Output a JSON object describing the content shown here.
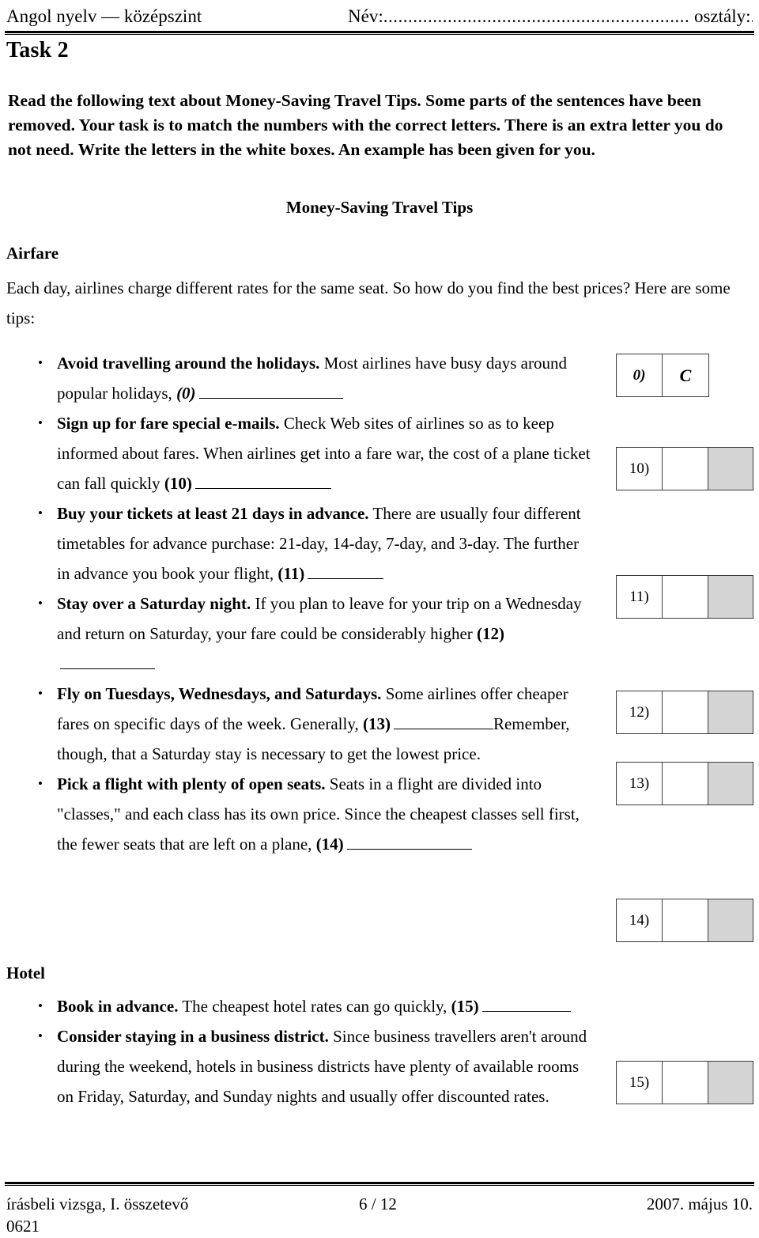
{
  "header": {
    "subject": "Angol nyelv — középszint",
    "name_label": "Név:",
    "name_dots": "..............................................................",
    "class_label": "osztály:......"
  },
  "task": {
    "title": "Task 2",
    "instructions": "Read the following text about Money-Saving Travel Tips. Some parts of the sentences have been removed. Your task is to match the numbers with the correct letters. There is an extra letter you do not need.  Write the letters in the white boxes. An example has been given for you."
  },
  "document": {
    "title": "Money-Saving Travel Tips",
    "sections": [
      {
        "heading": "Airfare",
        "intro": "Each day, airlines charge different rates for the same seat. So how do you find the best prices? Here are some tips:",
        "bullets": [
          {
            "lead": "Avoid travelling around the holidays.",
            "body_before": " Most airlines have busy days around popular holidays,",
            "number": "(0)",
            "body_after": ""
          },
          {
            "lead": "Sign up for fare special e-mails.",
            "body_before": " Check Web sites of airlines so as to keep informed about fares. When airlines get into a fare war, the cost of a plane ticket can fall quickly",
            "number": "(10)",
            "body_after": ""
          },
          {
            "lead": "Buy your tickets at least 21 days in advance.",
            "body_before": " There are usually four different timetables for advance purchase: 21-day, 14-day, 7-day, and 3-day. The further in advance you book your flight,",
            "number": "(11)",
            "body_after": ""
          },
          {
            "lead": "Stay over a Saturday night.",
            "body_before": " If you plan to leave for your trip on a Wednesday and return on Saturday, your fare could be considerably higher",
            "number": "(12)",
            "body_after": ""
          },
          {
            "lead": "Fly on Tuesdays, Wednesdays, and Saturdays.",
            "body_before": " Some airlines offer cheaper fares on specific days of the week. Generally,",
            "number": "(13)",
            "body_after": "Remember, though, that a Saturday stay is necessary to get the lowest price."
          },
          {
            "lead": "Pick a flight with plenty of open seats.",
            "body_before": " Seats in a flight are divided into \"classes,\" and each class has its own price. Since the cheapest classes sell first, the fewer seats that are left on a plane,",
            "number": "(14)",
            "body_after": ""
          }
        ]
      },
      {
        "heading": "Hotel",
        "bullets": [
          {
            "lead": "Book in advance.",
            "body_before": "  The cheapest hotel rates can go quickly,",
            "number": "(15)",
            "body_after": ""
          },
          {
            "lead": "Consider staying in a business district.",
            "body_before": " Since business travellers aren't around during the weekend, hotels in business districts have plenty of available rooms on Friday, Saturday, and Sunday nights and usually offer discounted rates.",
            "number": "",
            "body_after": ""
          }
        ]
      }
    ]
  },
  "answer_boxes": [
    {
      "label": "0)",
      "answer": "C",
      "example": true,
      "has_gray": false
    },
    {
      "label": "10)",
      "answer": "",
      "example": false,
      "has_gray": true
    },
    {
      "label": "11)",
      "answer": "",
      "example": false,
      "has_gray": true
    },
    {
      "label": "12)",
      "answer": "",
      "example": false,
      "has_gray": true
    },
    {
      "label": "13)",
      "answer": "",
      "example": false,
      "has_gray": true
    },
    {
      "label": "14)",
      "answer": "",
      "example": false,
      "has_gray": true
    },
    {
      "label": "15)",
      "answer": "",
      "example": false,
      "has_gray": true
    }
  ],
  "footer": {
    "left": "írásbeli vizsga, I. összetevő",
    "code": "0621",
    "page": "6 / 12",
    "date": "2007. május 10."
  },
  "colors": {
    "text": "#000000",
    "gray_cell": "#d4d4d4",
    "border": "#3a3a3a"
  }
}
